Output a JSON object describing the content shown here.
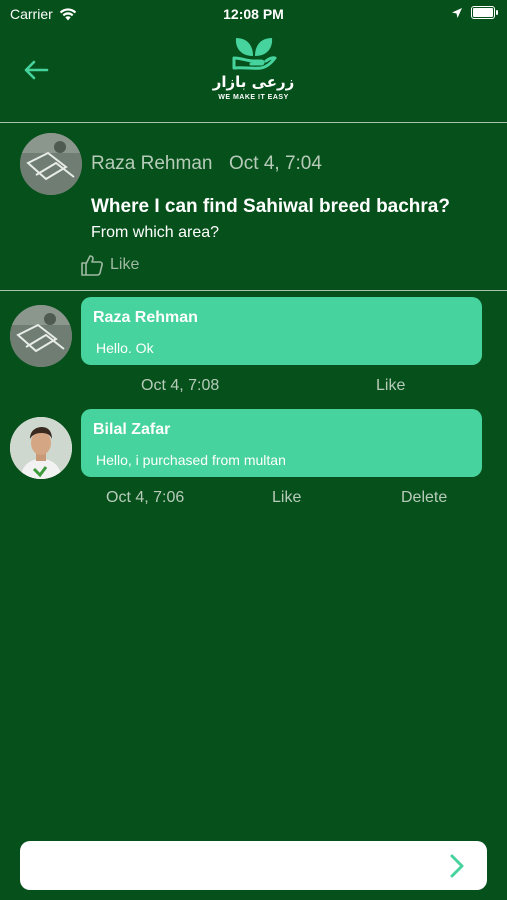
{
  "status_bar": {
    "carrier": "Carrier",
    "time": "12:08 PM"
  },
  "header": {
    "logo_urdu": "زرعی بازار",
    "logo_tagline": "WE MAKE IT EASY",
    "icons": {
      "back": "back-arrow-icon",
      "logo": "leaves-hand-logo"
    }
  },
  "post": {
    "author": "Raza Rehman",
    "date": "Oct 4, 7:04",
    "title": "Where I can find Sahiwal breed bachra?",
    "body": "From which area?",
    "like_label": "Like"
  },
  "comments": [
    {
      "author": "Raza Rehman",
      "text": "Hello. Ok",
      "date": "Oct 4, 7:08",
      "like_label": "Like"
    },
    {
      "author": "Bilal Zafar",
      "text": "Hello, i purchased from multan",
      "date": "Oct 4, 7:06",
      "like_label": "Like",
      "delete_label": "Delete"
    }
  ],
  "reply_input": {
    "value": "",
    "placeholder": ""
  },
  "colors": {
    "background": "#06501b",
    "accent": "#46d39d",
    "muted_text": "#b7cbb9"
  }
}
